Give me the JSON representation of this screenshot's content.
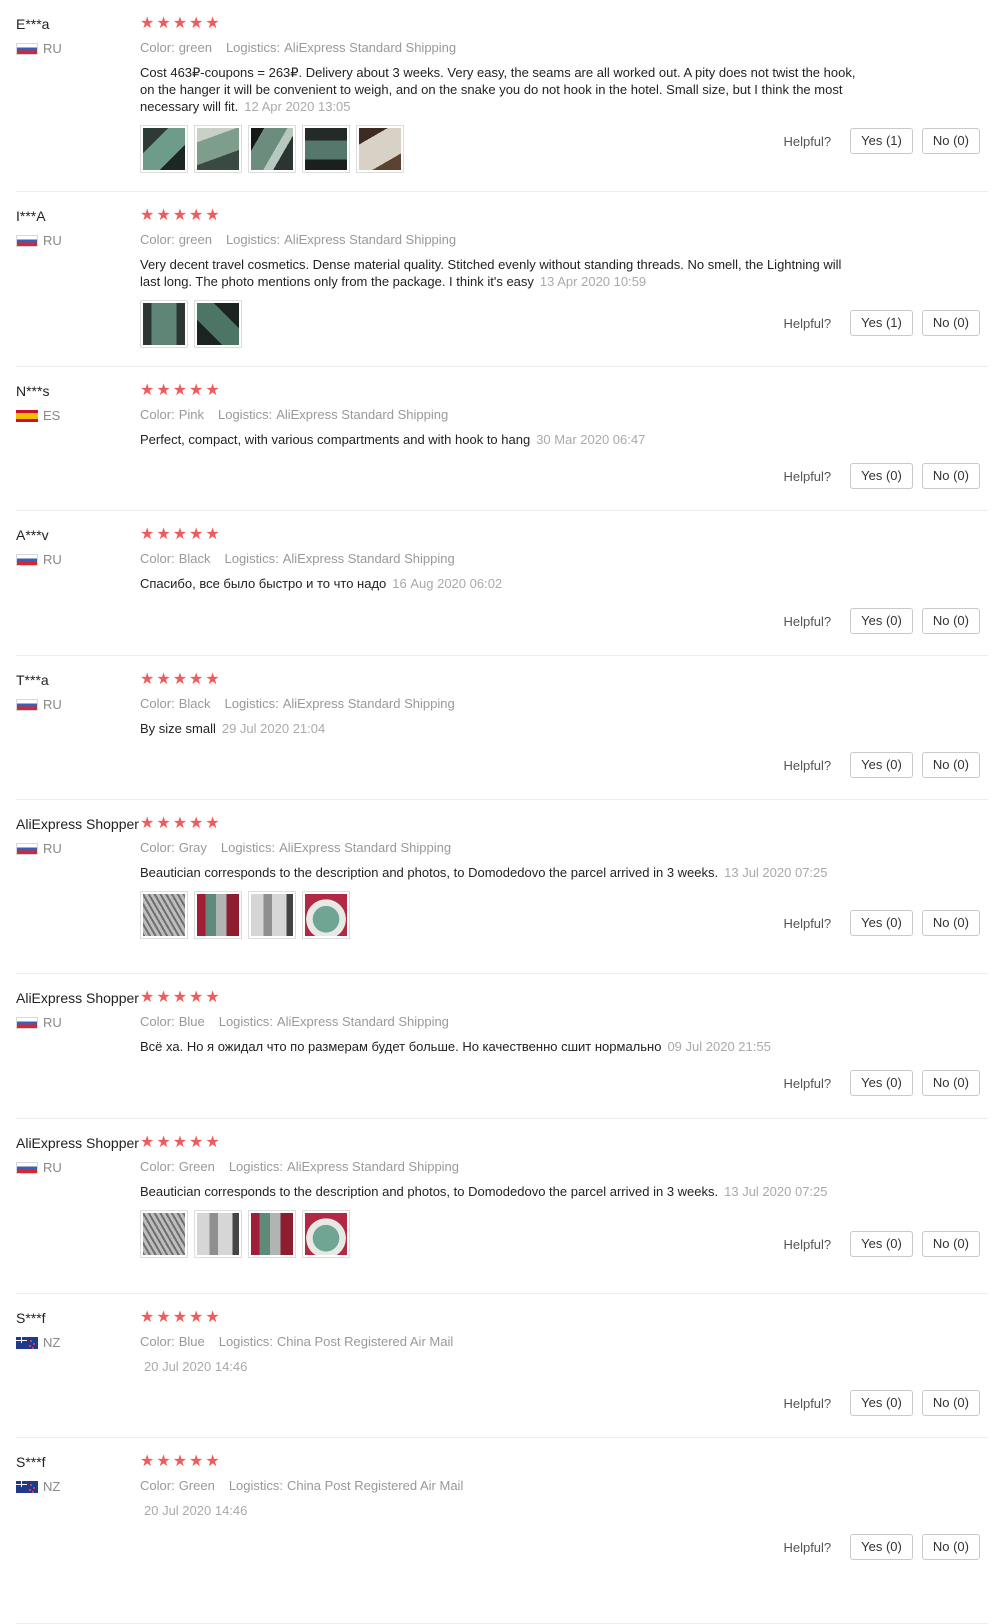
{
  "labels": {
    "color": "Color:",
    "logistics": "Logistics:",
    "helpful": "Helpful?"
  },
  "stars": [
    "★",
    "★",
    "★",
    "★",
    "★"
  ],
  "reviews": [
    {
      "user": "E***a",
      "country": "RU",
      "flag": "ru",
      "color": "green",
      "logistics": "AliExpress Standard Shipping",
      "text": "Cost 463₽-coupons = 263₽. Delivery about 3 weeks. Very easy, the seams are all worked out. A pity does not twist the hook, on the hanger it will be convenient to weigh, and on the snake you do not hook in the hotel. Small size, but I think the most necessary will fit.",
      "date": "12 Apr 2020 13:05",
      "photos": [
        "t1",
        "t2",
        "t3",
        "t4",
        "t5"
      ],
      "yes": "Yes (1)",
      "no": "No (0)"
    },
    {
      "user": "I***A",
      "country": "RU",
      "flag": "ru",
      "color": "green",
      "logistics": "AliExpress Standard Shipping",
      "text": "Very decent travel cosmetics. Dense material quality. Stitched evenly without standing threads. No smell, the Lightning will last long. The photo mentions only from the package. I think it's easy",
      "date": "13 Apr 2020 10:59",
      "photos": [
        "t6",
        "t7"
      ],
      "yes": "Yes (1)",
      "no": "No (0)"
    },
    {
      "user": "N***s",
      "country": "ES",
      "flag": "es",
      "color": "Pink",
      "logistics": "AliExpress Standard Shipping",
      "text": "Perfect, compact, with various compartments and with hook to hang",
      "date": "30 Mar 2020 06:47",
      "photos": [],
      "yes": "Yes (0)",
      "no": "No (0)"
    },
    {
      "user": "A***v",
      "country": "RU",
      "flag": "ru",
      "color": "Black",
      "logistics": "AliExpress Standard Shipping",
      "text": "Спасибо, все было быстро и то что надо",
      "date": "16 Aug 2020 06:02",
      "photos": [],
      "yes": "Yes (0)",
      "no": "No (0)"
    },
    {
      "user": "T***a",
      "country": "RU",
      "flag": "ru",
      "color": "Black",
      "logistics": "AliExpress Standard Shipping",
      "text": "By size small",
      "date": "29 Jul 2020 21:04",
      "photos": [],
      "yes": "Yes (0)",
      "no": "No (0)"
    },
    {
      "user": "AliExpress Shopper",
      "country": "RU",
      "flag": "ru",
      "color": "Gray",
      "logistics": "AliExpress Standard Shipping",
      "text": "Beautician corresponds to the description and photos, to Domodedovo the parcel arrived in 3 weeks.",
      "date": "13 Jul 2020 07:25",
      "photos": [
        "g1",
        "g2",
        "g3",
        "g4"
      ],
      "yes": "Yes (0)",
      "no": "No (0)"
    },
    {
      "user": "AliExpress Shopper",
      "country": "RU",
      "flag": "ru",
      "color": "Blue",
      "logistics": "AliExpress Standard Shipping",
      "text": "Всё ха. Но я ожидал что по размерам будет больше. Но качественно сшит нормально",
      "date": "09 Jul 2020 21:55",
      "photos": [],
      "yes": "Yes (0)",
      "no": "No (0)"
    },
    {
      "user": "AliExpress Shopper",
      "country": "RU",
      "flag": "ru",
      "color": "Green",
      "logistics": "AliExpress Standard Shipping",
      "text": "Beautician corresponds to the description and photos, to Domodedovo the parcel arrived in 3 weeks.",
      "date": "13 Jul 2020 07:25",
      "photos": [
        "g1",
        "g3",
        "g2",
        "g4"
      ],
      "yes": "Yes (0)",
      "no": "No (0)"
    },
    {
      "user": "S***f",
      "country": "NZ",
      "flag": "nz",
      "color": "Blue",
      "logistics": "China Post Registered Air Mail",
      "text": "",
      "date": "20 Jul 2020 14:46",
      "photos": [],
      "yes": "Yes (0)",
      "no": "No (0)"
    },
    {
      "user": "S***f",
      "country": "NZ",
      "flag": "nz",
      "color": "Green",
      "logistics": "China Post Registered Air Mail",
      "text": "",
      "date": "20 Jul 2020 14:46",
      "photos": [],
      "yes": "Yes (0)",
      "no": "No (0)"
    }
  ]
}
